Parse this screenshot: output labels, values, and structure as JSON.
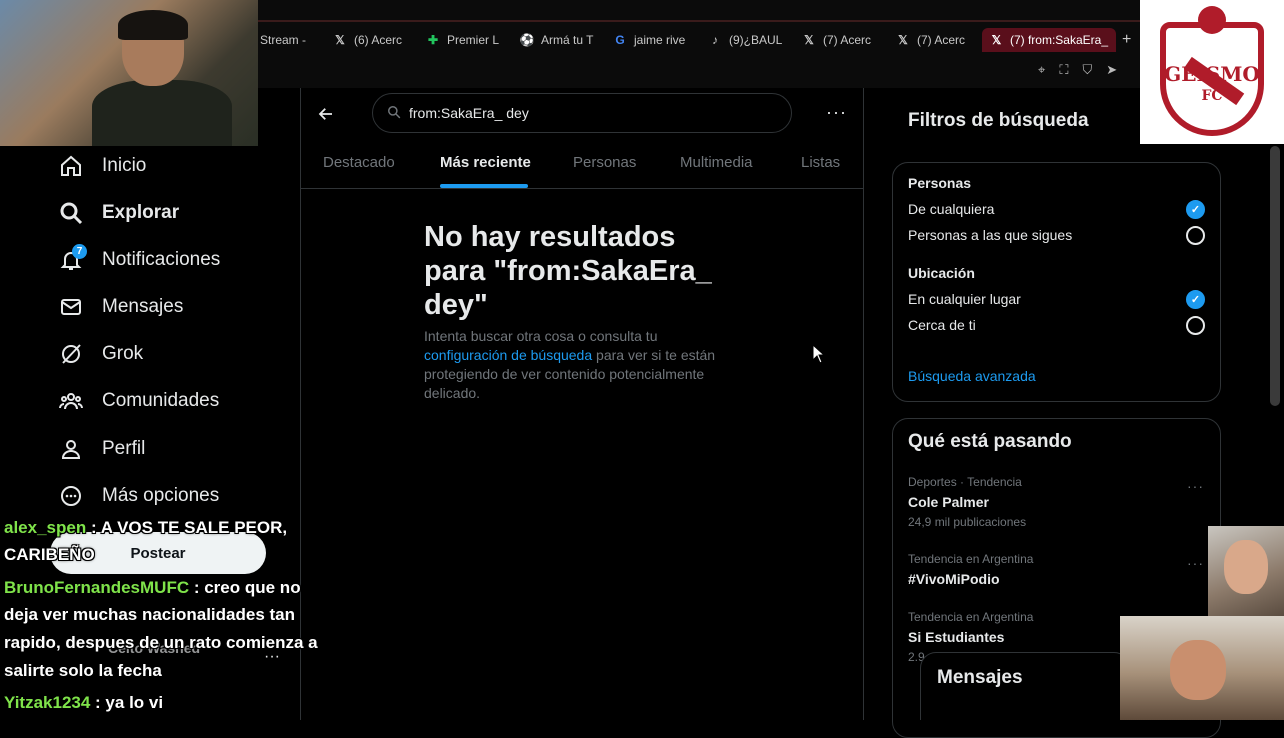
{
  "browser": {
    "tabs": [
      {
        "label": "Stream -",
        "icon": "stream-icon"
      },
      {
        "label": "(6) Acerc",
        "icon": "x-logo-icon"
      },
      {
        "label": "Premier L",
        "icon": "premier-league-icon"
      },
      {
        "label": "Armá tu T",
        "icon": "soccer-ball-icon"
      },
      {
        "label": "jaime rive",
        "icon": "google-icon"
      },
      {
        "label": "(9)¿BAUL",
        "icon": "tiktok-icon"
      },
      {
        "label": "(7) Acerc",
        "icon": "x-logo-icon"
      },
      {
        "label": "(7) Acerc",
        "icon": "x-logo-icon"
      },
      {
        "label": "(7) from:SakaEra_",
        "icon": "x-logo-icon",
        "active": true
      }
    ],
    "new_tab": "+"
  },
  "nav": {
    "items": [
      {
        "label": "Inicio",
        "icon": "home-icon"
      },
      {
        "label": "Explorar",
        "icon": "search-icon",
        "active": true
      },
      {
        "label": "Notificaciones",
        "icon": "bell-icon"
      },
      {
        "label": "Mensajes",
        "icon": "envelope-icon"
      },
      {
        "label": "Grok",
        "icon": "grok-icon"
      },
      {
        "label": "Comunidades",
        "icon": "communities-icon"
      },
      {
        "label": "Perfil",
        "icon": "person-icon"
      },
      {
        "label": "Más opciones",
        "icon": "more-circle-icon"
      }
    ],
    "notifications_badge": "7",
    "post_button": "Postear",
    "account_name": "Ceito Washed",
    "account_more": "···"
  },
  "search": {
    "query": "from:SakaEra_dey",
    "display": "from:SakaEra_ dey",
    "tabs": [
      "Destacado",
      "Más reciente",
      "Personas",
      "Multimedia",
      "Listas"
    ],
    "active_tab": "Más reciente"
  },
  "empty_state": {
    "title": "No hay resultados para \"from:SakaEra_ dey\"",
    "body_before": "Intenta buscar otra cosa o consulta tu ",
    "body_link": "configuración de búsqueda",
    "body_after": " para ver si te están protegiendo de ver contenido potencialmente delicado."
  },
  "filters": {
    "title": "Filtros de búsqueda",
    "people_heading": "Personas",
    "people_options": [
      {
        "label": "De cualquiera",
        "selected": true
      },
      {
        "label": "Personas a las que sigues",
        "selected": false
      }
    ],
    "location_heading": "Ubicación",
    "location_options": [
      {
        "label": "En cualquier lugar",
        "selected": true
      },
      {
        "label": "Cerca de ti",
        "selected": false
      }
    ],
    "advanced_link": "Búsqueda avanzada"
  },
  "trends": {
    "title": "Qué está pasando",
    "items": [
      {
        "meta": "Deportes · Tendencia",
        "name": "Cole Palmer",
        "count": "24,9 mil publicaciones"
      },
      {
        "meta": "Tendencia en Argentina",
        "name": "#VivoMiPodio",
        "count": ""
      },
      {
        "meta": "Tendencia en Argentina",
        "name": "Si Estudiantes",
        "count": "2.9"
      }
    ]
  },
  "messages_drawer": "Mensajes",
  "logo": {
    "name": "GEISMO",
    "sub": "FC"
  },
  "chat": [
    {
      "user": "alex_spen",
      "text": " : A VOS TE SALE PEOR,"
    },
    {
      "user": "",
      "text": "CARIBEÑO"
    },
    {
      "user": "BrunoFernandesMUFC",
      "text": " : creo que no"
    },
    {
      "user": "",
      "text": "deja ver muchas nacionalidades tan"
    },
    {
      "user": "",
      "text": "rapido, despues de un rato comienza a"
    },
    {
      "user": "",
      "text": "salirte solo la fecha"
    },
    {
      "user": "Yitzak1234",
      "text": " : ya lo vi"
    }
  ],
  "colors": {
    "accent": "#1d9bf0",
    "background": "#000000",
    "chat_user": "#7fe34a",
    "logo_red": "#b01c2a"
  }
}
